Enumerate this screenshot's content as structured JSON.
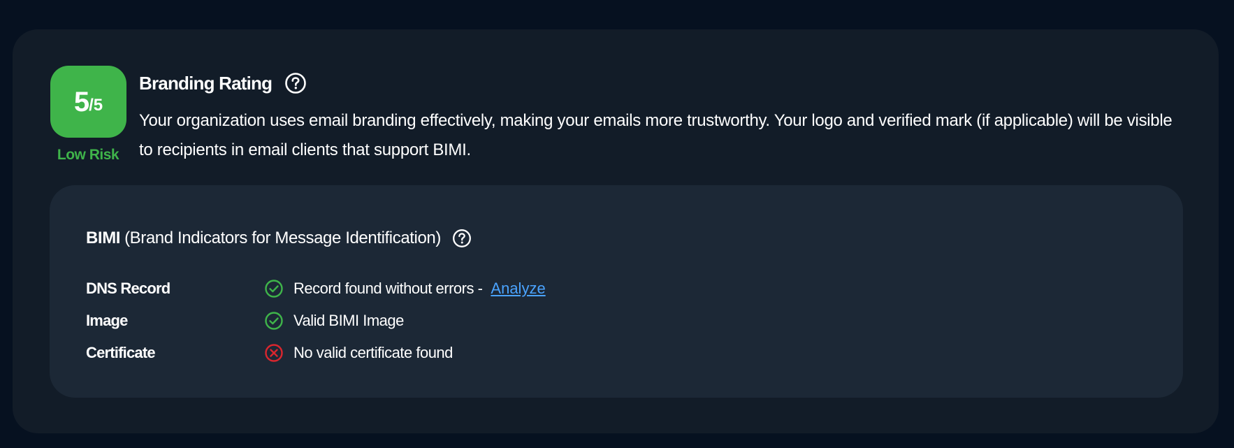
{
  "rating": {
    "score": "5",
    "denominator": "/5",
    "risk_label": "Low Risk",
    "title": "Branding Rating",
    "description": "Your organization uses email branding effectively, making your emails more trustworthy. Your logo and verified mark (if applicable) will be visible to recipients in email clients that support BIMI.",
    "help_icon": "question-circle-icon"
  },
  "bimi": {
    "abbr": "BIMI",
    "full_name": "(Brand Indicators for Message Identification)",
    "help_icon": "question-circle-icon",
    "rows": [
      {
        "label": "DNS Record",
        "status": "ok",
        "icon": "check-circle-icon",
        "text": "Record found without errors -",
        "link": "Analyze"
      },
      {
        "label": "Image",
        "status": "ok",
        "icon": "check-circle-icon",
        "text": "Valid BIMI Image"
      },
      {
        "label": "Certificate",
        "status": "error",
        "icon": "x-circle-icon",
        "text": "No valid certificate found"
      }
    ]
  },
  "colors": {
    "background": "#061120",
    "card": "#121c28",
    "panel": "#1c2836",
    "success": "#3fb44a",
    "error": "#d9262e",
    "link": "#4aa3ff"
  }
}
